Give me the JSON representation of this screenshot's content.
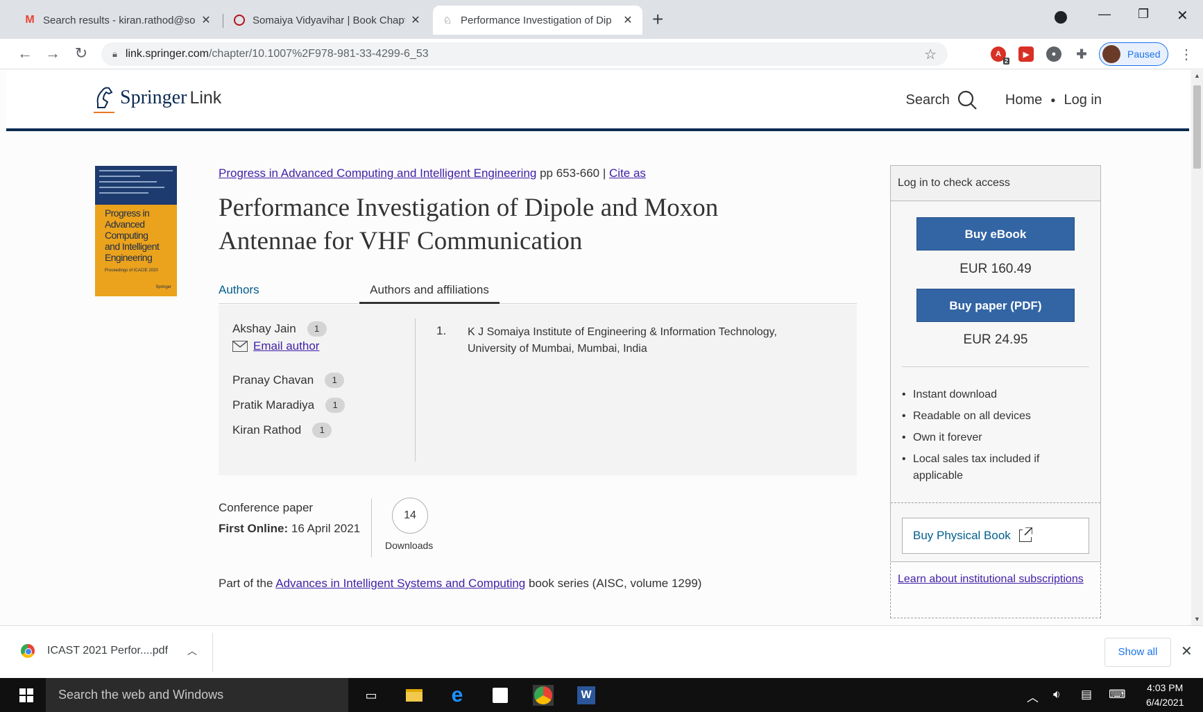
{
  "browser": {
    "tabs": [
      {
        "title": "Search results - kiran.rathod@so",
        "icon": "gmail-icon"
      },
      {
        "title": "Somaiya Vidyavihar | Book Chapt",
        "icon": "somaiya-icon"
      },
      {
        "title": "Performance Investigation of Dip",
        "icon": "springer-icon",
        "active": true
      }
    ],
    "url_host": "link.springer.com",
    "url_path": "/chapter/10.1007%2F978-981-33-4299-6_53",
    "profile_status": "Paused",
    "extension_badge": "2"
  },
  "header": {
    "brand": "Springer",
    "brand_suffix": "Link",
    "search_label": "Search",
    "home_label": "Home",
    "login_label": "Log in"
  },
  "book": {
    "cover_title": "Progress in Advanced Computing and Intelligent Engineering",
    "cover_title_lines": [
      "Progress in",
      "Advanced",
      "Computing",
      "and Intelligent",
      "Engineering"
    ],
    "cover_subtitle": "Proceedings of ICACIE 2020",
    "cover_publisher": "Springer"
  },
  "chapter": {
    "book_link": "Progress in Advanced Computing and Intelligent Engineering",
    "pages": "pp 653-660",
    "separator": "|",
    "cite_label": "Cite as",
    "title": "Performance Investigation of Dipole and Moxon Antennae for VHF Communication",
    "tab_authors": "Authors",
    "tab_affiliations": "Authors and affiliations",
    "authors": [
      {
        "name": "Akshay Jain",
        "aff": "1"
      },
      {
        "name": "Pranay Chavan",
        "aff": "1"
      },
      {
        "name": "Pratik Maradiya",
        "aff": "1"
      },
      {
        "name": "Kiran Rathod",
        "aff": "1"
      }
    ],
    "email_label": "Email author",
    "institution_num": "1.",
    "institution": "K J Somaiya Institute of Engineering & Information Technology, University of Mumbai, Mumbai, India",
    "type": "Conference paper",
    "first_online_label": "First Online:",
    "first_online_date": "16 April 2021",
    "downloads": "14",
    "downloads_label": "Downloads",
    "series_prefix": "Part of the",
    "series_link": "Advances in Intelligent Systems and Computing",
    "series_suffix": "book series (AISC, volume 1299)"
  },
  "buy": {
    "header": "Log in to check access",
    "ebook_label": "Buy eBook",
    "ebook_price": "EUR 160.49",
    "paper_label": "Buy paper (PDF)",
    "paper_price": "EUR 24.95",
    "features": [
      "Instant download",
      "Readable on all devices",
      "Own it forever",
      "Local sales tax included if applicable"
    ],
    "physical_label": "Buy Physical Book",
    "learn_label": "Learn about institutional subscriptions"
  },
  "downloads_bar": {
    "file": "ICAST 2021 Perfor....pdf",
    "show_all": "Show all"
  },
  "taskbar": {
    "search_placeholder": "Search the web and Windows",
    "time": "4:03 PM",
    "date": "6/4/2021"
  }
}
